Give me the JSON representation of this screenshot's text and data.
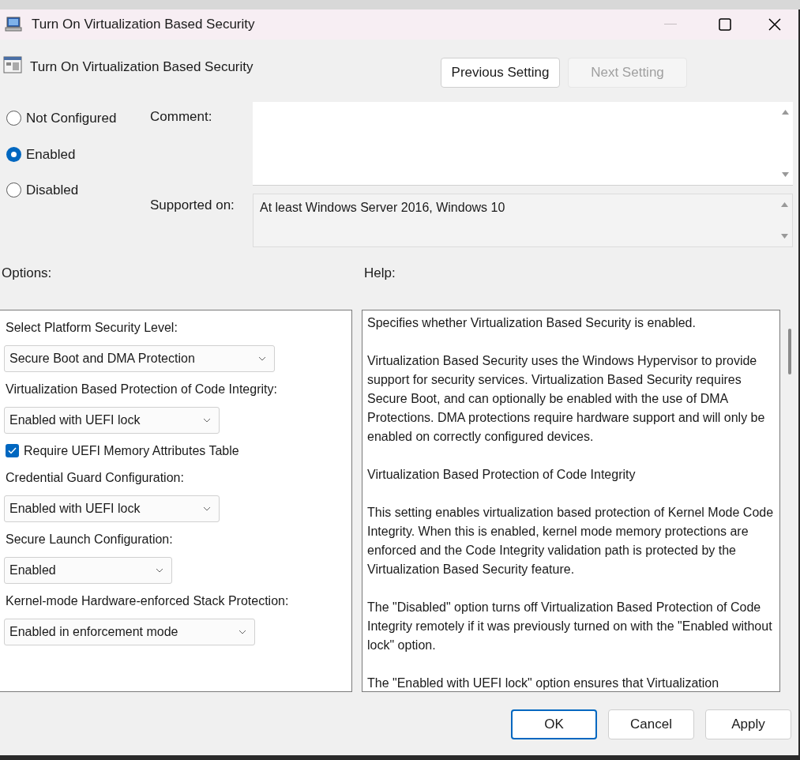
{
  "window": {
    "title": "Turn On Virtualization Based Security",
    "minimize_disabled": true
  },
  "header": {
    "title": "Turn On Virtualization Based Security"
  },
  "nav_buttons": [
    {
      "label": "Previous Setting",
      "disabled": false
    },
    {
      "label": "Next Setting",
      "disabled": true
    }
  ],
  "state_options": [
    {
      "label": "Not Configured",
      "selected": false
    },
    {
      "label": "Enabled",
      "selected": true
    },
    {
      "label": "Disabled",
      "selected": false
    }
  ],
  "comment": {
    "label": "Comment:"
  },
  "supported_on": {
    "label": "Supported on:",
    "value": "At least Windows Server 2016, Windows 10"
  },
  "options": {
    "label": "Options:",
    "items": [
      {
        "kind": "label",
        "text": "Select Platform Security Level:"
      },
      {
        "kind": "dropdown",
        "text": "Secure Boot and DMA Protection"
      },
      {
        "kind": "label",
        "text": "Virtualization Based Protection of Code Integrity:"
      },
      {
        "kind": "dropdown",
        "text": "Enabled with UEFI lock"
      },
      {
        "kind": "checkbox",
        "text": "Require UEFI Memory Attributes Table",
        "checked": true
      },
      {
        "kind": "label",
        "text": "Credential Guard Configuration:"
      },
      {
        "kind": "dropdown",
        "text": "Enabled with UEFI lock"
      },
      {
        "kind": "label",
        "text": "Secure Launch Configuration:"
      },
      {
        "kind": "dropdown",
        "text": "Enabled"
      },
      {
        "kind": "label",
        "text": "Kernel-mode Hardware-enforced Stack Protection:"
      },
      {
        "kind": "dropdown",
        "text": "Enabled in enforcement mode"
      }
    ]
  },
  "help": {
    "label": "Help:",
    "paragraphs": [
      "Specifies whether Virtualization Based Security is enabled.",
      "Virtualization Based Security uses the Windows Hypervisor to provide support for security services. Virtualization Based Security requires Secure Boot, and can optionally be enabled with the use of DMA Protections. DMA protections require hardware support and will only be enabled on correctly configured devices.",
      "Virtualization Based Protection of Code Integrity",
      "This setting enables virtualization based protection of Kernel Mode Code Integrity. When this is enabled, kernel mode memory protections are enforced and the Code Integrity validation path is protected by the Virtualization Based Security feature.",
      "The \"Disabled\" option turns off Virtualization Based Protection of Code Integrity remotely if it was previously turned on with the \"Enabled without lock\" option.",
      "The \"Enabled with UEFI lock\" option ensures that Virtualization"
    ]
  },
  "footer_buttons": [
    {
      "label": "OK",
      "default": true
    },
    {
      "label": "Cancel",
      "default": false
    },
    {
      "label": "Apply",
      "default": false
    }
  ]
}
